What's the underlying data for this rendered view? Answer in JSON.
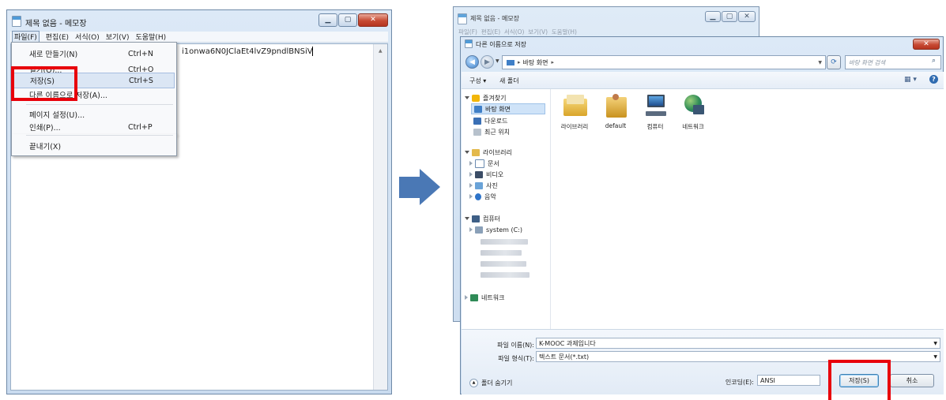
{
  "notepad": {
    "title": "제목 없음 - 메모장",
    "menu": [
      "파일(F)",
      "편집(E)",
      "서식(O)",
      "보기(V)",
      "도움말(H)"
    ],
    "editor_text": "i1onwa6N0JClaEt4lvZ9pndlBNSiV",
    "file_menu": [
      {
        "label": "새로 만들기(N)",
        "shortcut": "Ctrl+N"
      },
      {
        "label": "열기(O)...",
        "shortcut": "Ctrl+O"
      },
      {
        "label": "저장(S)",
        "shortcut": "Ctrl+S"
      },
      {
        "label": "다른 이름으로 저장(A)...",
        "shortcut": ""
      },
      {
        "label": "페이지 설정(U)...",
        "shortcut": ""
      },
      {
        "label": "인쇄(P)...",
        "shortcut": "Ctrl+P"
      },
      {
        "label": "끝내기(X)",
        "shortcut": ""
      }
    ]
  },
  "dialog": {
    "bg_window_title": "제목 없음 - 메모장",
    "bg_menu": "파일(F)  편집(E)  서식(O)  보기(V)  도움말(H)",
    "title": "다른 이름으로 저장",
    "address": "바탕 화면",
    "search_placeholder": "바탕 화면 검색",
    "organize": "구성 ▾",
    "new_folder": "새 폴더",
    "nav": {
      "favorites": "즐겨찾기",
      "desktop": "바탕 화면",
      "downloads": "다운로드",
      "recent": "최근 위치",
      "libraries": "라이브러리",
      "documents": "문서",
      "videos": "비디오",
      "pictures": "사진",
      "music": "음악",
      "computer": "컴퓨터",
      "system_c": "system (C:)",
      "network": "네트워크"
    },
    "files": [
      "라이브러리",
      "default",
      "컴퓨터",
      "네트워크"
    ],
    "filename_label": "파일 이름(N):",
    "filename_value": "K-MOOC 과제입니다",
    "filetype_label": "파일 형식(T):",
    "filetype_value": "텍스트 문서(*.txt)",
    "hide_folders": "폴더 숨기기",
    "encoding_label": "인코딩(E):",
    "encoding_value": "ANSI",
    "save_button": "저장(S)",
    "cancel_button": "취소"
  },
  "colors": {
    "highlight_red": "#e8000b",
    "arrow_blue": "#4a78b5"
  }
}
